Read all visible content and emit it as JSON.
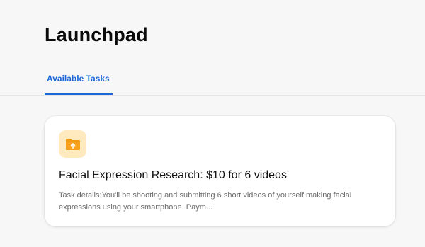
{
  "header": {
    "title": "Launchpad"
  },
  "tabs": [
    {
      "label": "Available Tasks",
      "active": true
    }
  ],
  "task": {
    "icon": "upload-folder-icon",
    "title": "Facial Expression Research: $10 for 6 videos",
    "details": "Task details:You'll be shooting and submitting 6 short videos of yourself making facial expressions using your smartphone. Paym..."
  },
  "colors": {
    "accent": "#1a66d6",
    "icon_bg": "#ffe9bf",
    "icon_fill": "#f29a12",
    "page_bg": "#f7f7f8"
  }
}
